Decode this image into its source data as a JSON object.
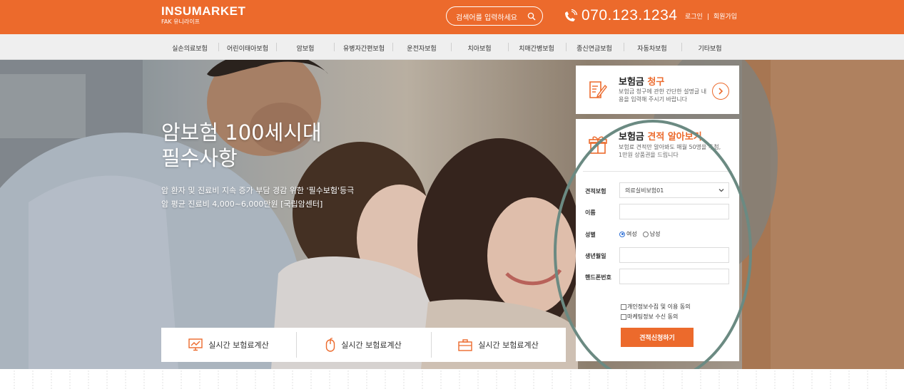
{
  "header": {
    "logo_main": "INSUMARKET",
    "logo_sub": "FAK 유니라이프",
    "search_placeholder": "검색어를 입력하세요",
    "phone": "070.123.1234",
    "login": "로그인",
    "auth_sep": "|",
    "signup": "회원가입",
    "brand_color": "#ec6a2c"
  },
  "nav": {
    "items": [
      "실손의료보험",
      "어린이태아보험",
      "암보험",
      "유병자간편보험",
      "운전자보험",
      "치아보험",
      "치매간병보험",
      "종신연금보험",
      "자동차보험",
      "기타보험"
    ]
  },
  "hero": {
    "headline_1": "암보험 100세시대",
    "headline_2": "필수사항",
    "sub_1": "암 환자 및 진료비 지속 증가 부담 경감 위한 '필수보험'등극",
    "sub_2": "암 평균 진료비 4,000~6,000만원 [국립암센터]"
  },
  "calc": {
    "items": [
      {
        "label": "실시간 보험료계산",
        "icon": "monitor-chart-icon"
      },
      {
        "label": "실시간 보험료계산",
        "icon": "mouse-icon"
      },
      {
        "label": "실시간 보험료계산",
        "icon": "briefcase-icon"
      }
    ]
  },
  "claim": {
    "title_prefix": "보험금 ",
    "title_accent": "청구",
    "desc": "보험금 청구에 관한 간단한 설명글 내용을 입력해 주시기 바랍니다"
  },
  "quote": {
    "title_prefix": "보험금 ",
    "title_accent": "견적 알아보기",
    "desc_1": "보험료 견적만 알아봐도 매월 50명을 추첨,",
    "desc_2": "1만원 상품권을 드립니다",
    "label_insurance": "견적보험",
    "selected_insurance": "의료실비보험01",
    "label_name": "이름",
    "label_gender": "성별",
    "gender_female": "여성",
    "gender_male": "남성",
    "gender_selected": "female",
    "label_birth": "생년월일",
    "label_phone": "핸드폰번호",
    "consent_privacy": "개인정보수집 및 이용 동의",
    "consent_marketing": "마케팅정보 수신 동의",
    "submit": "견적신청하기"
  }
}
